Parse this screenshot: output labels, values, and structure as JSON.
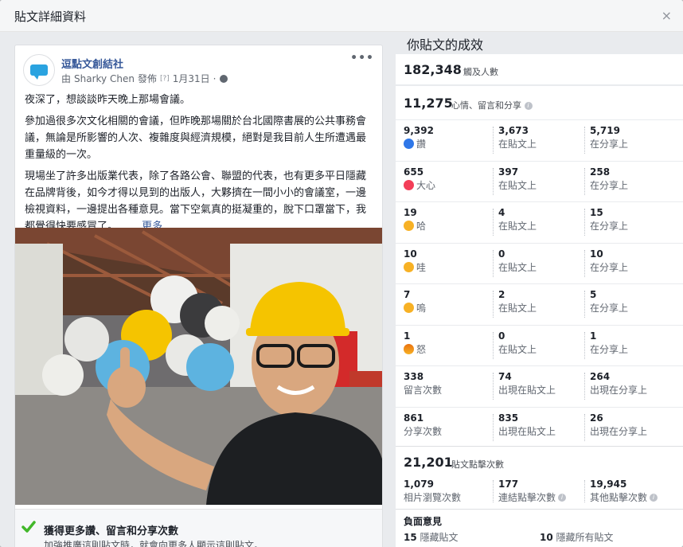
{
  "dialog": {
    "title": "貼文詳細資料",
    "close": "×"
  },
  "post": {
    "page_name": "逗點文創結社",
    "author_prefix": "由",
    "author": "Sharky Chen",
    "published": "發佈",
    "help_mark": "[?]",
    "date": "1月31日",
    "dot": "·",
    "menu": "•••",
    "paragraphs": [
      "夜深了，想談談昨天晚上那場會議。",
      "參加過很多次文化相關的會議，但昨晚那場關於台北國際書展的公共事務會議，無論是所影響的人次、複雜度與經濟規模，絕對是我目前人生所遭遇最重量級的一次。",
      "現場坐了許多出版業代表，除了各路公會、聯盟的代表，也有更多平日隱藏在品牌背後，如今才得以見到的出版人，大夥擠在一間小小的會議室，一邊檢視資料，一邊提出各種意見。當下空氣真的挺凝重的，脫下口罩當下，我都覺得快要感冒了。……"
    ],
    "more": "更多",
    "boost_title": "獲得更多讚、留言和分享次數",
    "boost_desc": "加強推廣這則貼文時，就會向更多人顯示這則貼文。"
  },
  "stats": {
    "heading": "你貼文的成效",
    "reach": {
      "value": "182,348",
      "label": "觸及人數"
    },
    "engagement": {
      "value": "11,275",
      "label": "心情、留言和分享"
    },
    "rows": [
      {
        "icon": "like-icon",
        "cells": [
          {
            "n": "9,392",
            "l": "讚"
          },
          {
            "n": "3,673",
            "l": "在貼文上"
          },
          {
            "n": "5,719",
            "l": "在分享上"
          }
        ]
      },
      {
        "icon": "love-icon",
        "cells": [
          {
            "n": "655",
            "l": "大心"
          },
          {
            "n": "397",
            "l": "在貼文上"
          },
          {
            "n": "258",
            "l": "在分享上"
          }
        ]
      },
      {
        "icon": "haha-icon",
        "cells": [
          {
            "n": "19",
            "l": "哈"
          },
          {
            "n": "4",
            "l": "在貼文上"
          },
          {
            "n": "15",
            "l": "在分享上"
          }
        ]
      },
      {
        "icon": "wow-icon",
        "cells": [
          {
            "n": "10",
            "l": "哇"
          },
          {
            "n": "0",
            "l": "在貼文上"
          },
          {
            "n": "10",
            "l": "在分享上"
          }
        ]
      },
      {
        "icon": "sad-icon",
        "cells": [
          {
            "n": "7",
            "l": "嗚"
          },
          {
            "n": "2",
            "l": "在貼文上"
          },
          {
            "n": "5",
            "l": "在分享上"
          }
        ]
      },
      {
        "icon": "angry-icon",
        "cells": [
          {
            "n": "1",
            "l": "怒"
          },
          {
            "n": "0",
            "l": "在貼文上"
          },
          {
            "n": "1",
            "l": "在分享上"
          }
        ]
      },
      {
        "icon": "",
        "cells": [
          {
            "n": "338",
            "l": "留言次數"
          },
          {
            "n": "74",
            "l": "出現在貼文上"
          },
          {
            "n": "264",
            "l": "出現在分享上"
          }
        ]
      },
      {
        "icon": "",
        "cells": [
          {
            "n": "861",
            "l": "分享次數"
          },
          {
            "n": "835",
            "l": "出現在貼文上"
          },
          {
            "n": "26",
            "l": "出現在分享上"
          }
        ]
      }
    ],
    "clicks": {
      "value": "21,201",
      "label": "貼文點擊次數",
      "cells": [
        {
          "n": "1,079",
          "l": "相片瀏覽次數"
        },
        {
          "n": "177",
          "l": "連結點擊次數"
        },
        {
          "n": "19,945",
          "l": "其他點擊次數"
        }
      ]
    },
    "negative": {
      "title": "負面意見",
      "items": [
        {
          "n": "15",
          "l": "隱藏貼文"
        },
        {
          "n": "10",
          "l": "隱藏所有貼文"
        }
      ]
    }
  },
  "colors": {
    "link": "#365899",
    "accent": "#2aa3e0",
    "check": "#42b72a",
    "helmet": "#f5c400"
  }
}
